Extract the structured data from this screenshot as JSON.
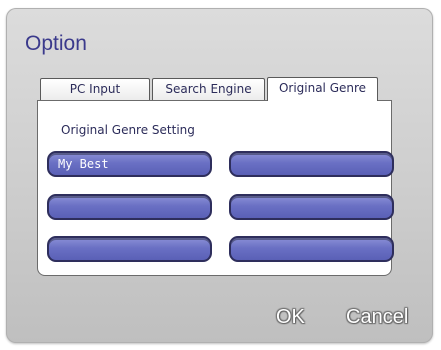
{
  "dialog": {
    "title": "Option"
  },
  "tabs": [
    {
      "label": "PC Input",
      "active": false
    },
    {
      "label": "Search Engine",
      "active": false
    },
    {
      "label": "Original Genre",
      "active": true
    }
  ],
  "panel": {
    "heading": "Original Genre Setting",
    "slots": [
      {
        "value": "My Best"
      },
      {
        "value": ""
      },
      {
        "value": ""
      },
      {
        "value": ""
      },
      {
        "value": ""
      },
      {
        "value": ""
      }
    ]
  },
  "buttons": {
    "ok_label": "OK",
    "cancel_label": "Cancel"
  },
  "colors": {
    "title": "#3b3a8c",
    "slot_fill": "#6a70c4",
    "slot_border": "#2e2e5c"
  }
}
